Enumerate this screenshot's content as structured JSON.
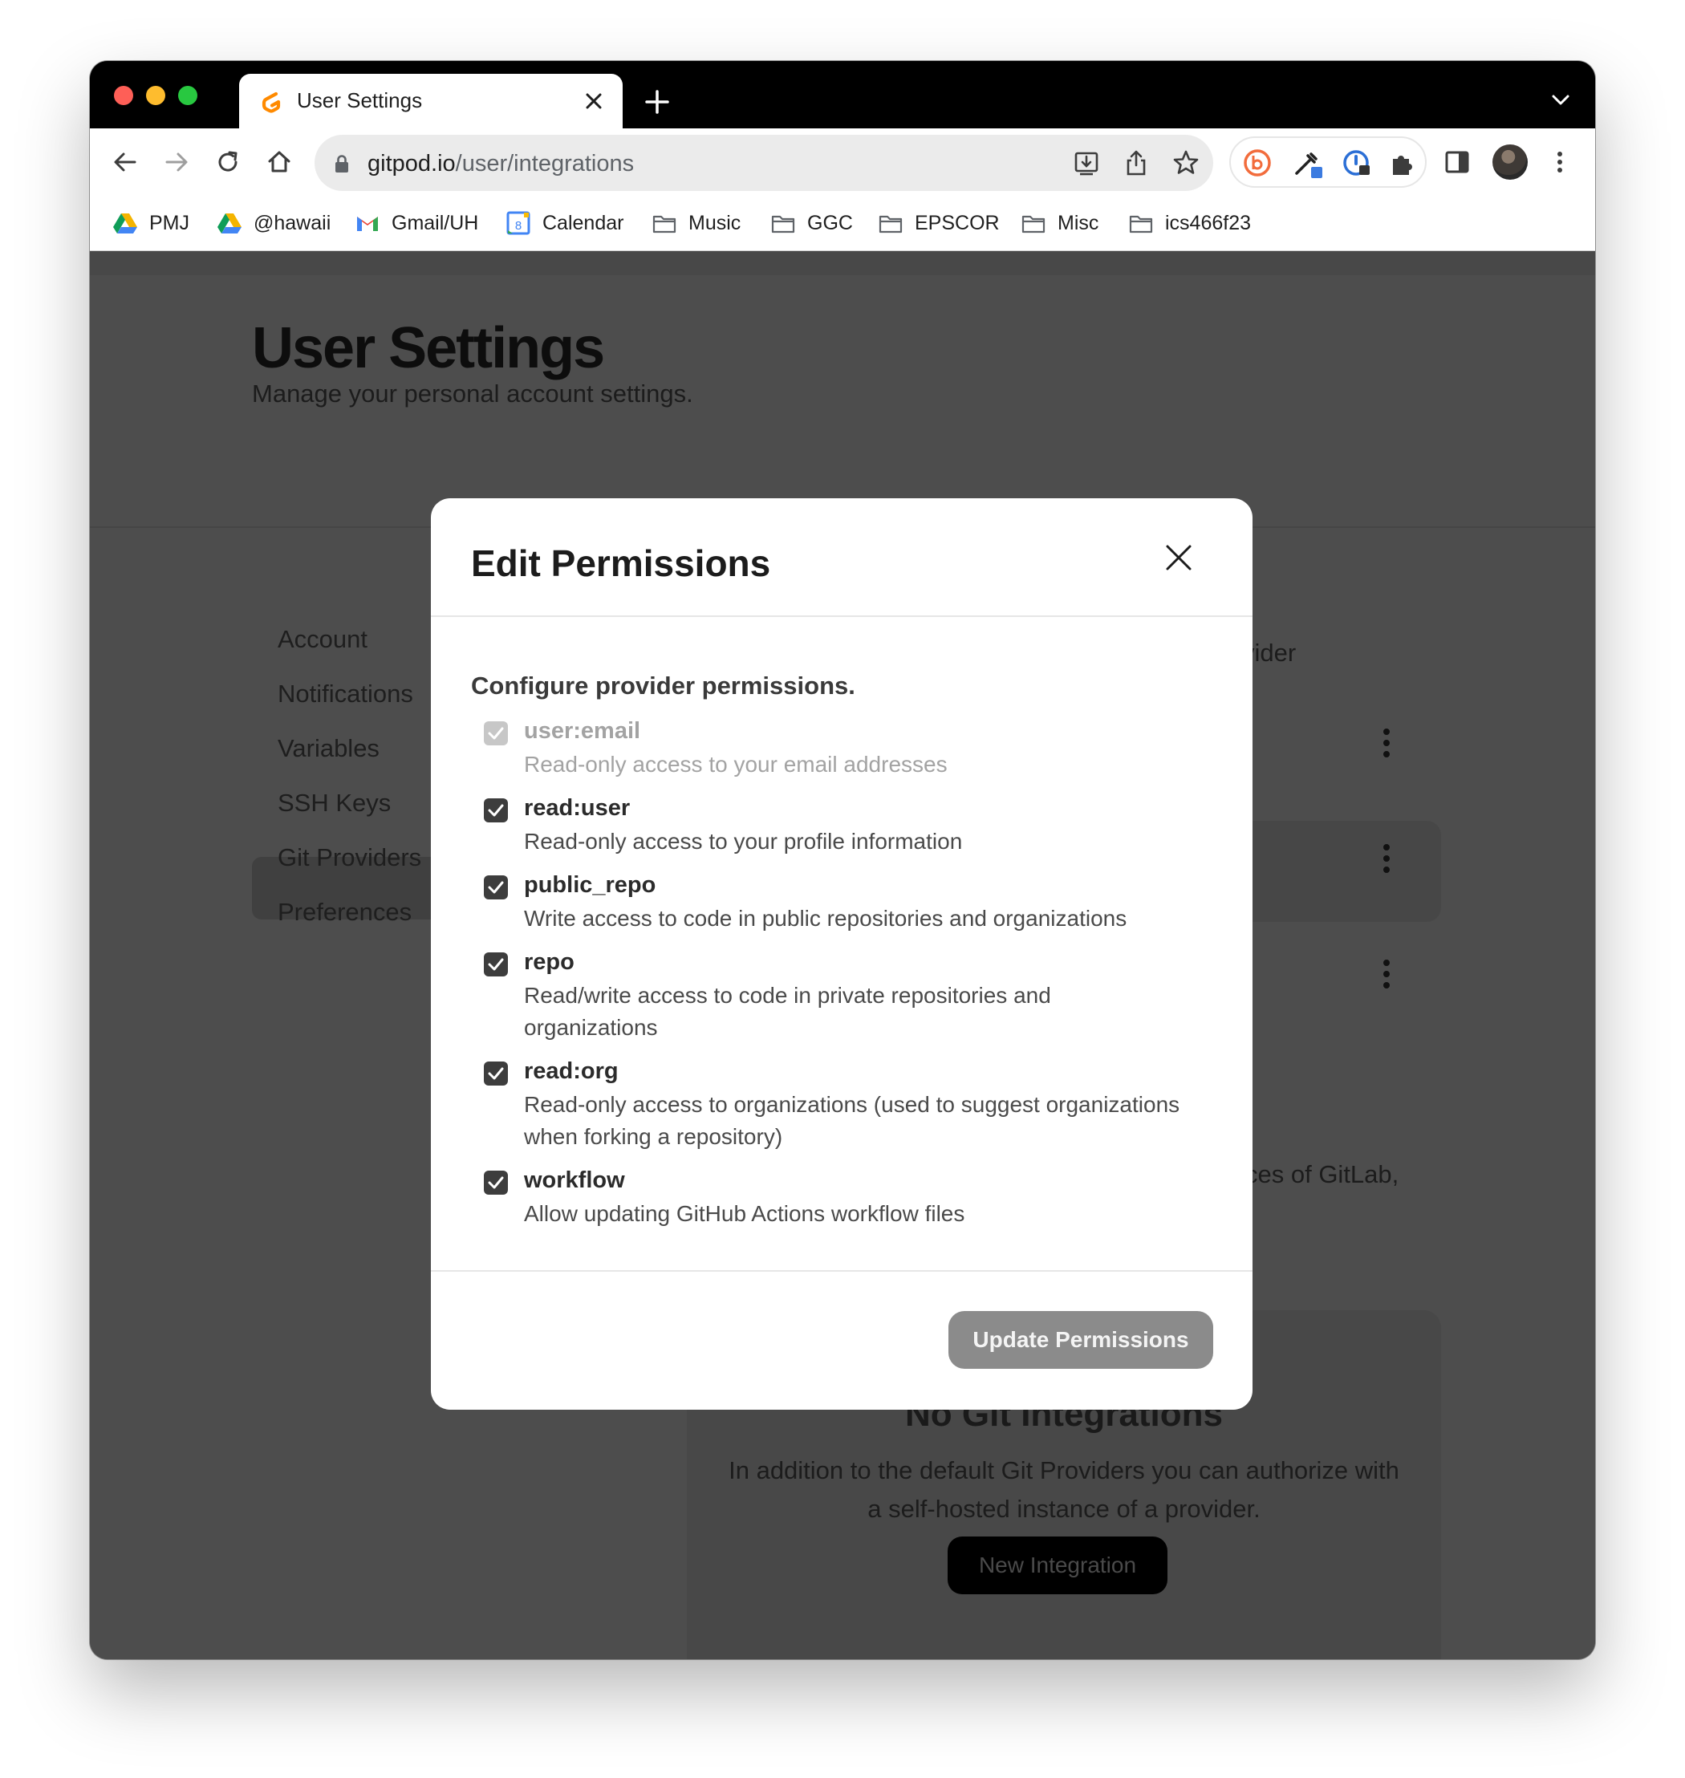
{
  "browser": {
    "tab_title": "User Settings",
    "url_host": "gitpod.io",
    "url_path": "/user/integrations",
    "bookmarks": [
      {
        "label": "PMJ",
        "icon": "google-drive-icon"
      },
      {
        "label": "@hawaii",
        "icon": "google-drive-icon"
      },
      {
        "label": "Gmail/UH",
        "icon": "gmail-icon"
      },
      {
        "label": "Calendar",
        "icon": "google-calendar-icon"
      },
      {
        "label": "Music",
        "icon": "folder-icon"
      },
      {
        "label": "GGC",
        "icon": "folder-icon"
      },
      {
        "label": "EPSCOR",
        "icon": "folder-icon"
      },
      {
        "label": "Misc",
        "icon": "folder-icon"
      },
      {
        "label": "ics466f23",
        "icon": "folder-icon"
      }
    ],
    "calendar_day": "8"
  },
  "page": {
    "title": "User Settings",
    "subtitle": "Manage your personal account settings.",
    "sidebar": [
      {
        "label": "Account"
      },
      {
        "label": "Notifications"
      },
      {
        "label": "Variables"
      },
      {
        "label": "SSH Keys"
      },
      {
        "label": "Git Providers",
        "active": true
      },
      {
        "label": "Preferences"
      }
    ],
    "fragment_provider": "vider",
    "fragment_gitlab": "ces of GitLab,",
    "empty_state": {
      "title": "No Git Integrations",
      "text": "In addition to the default Git Providers you can authorize with a self-hosted instance of a provider.",
      "button": "New Integration"
    }
  },
  "modal": {
    "title": "Edit Permissions",
    "intro": "Configure provider permissions.",
    "permissions": [
      {
        "name": "user:email",
        "description": "Read-only access to your email addresses",
        "checked": true,
        "disabled": true
      },
      {
        "name": "read:user",
        "description": "Read-only access to your profile information",
        "checked": true,
        "disabled": false
      },
      {
        "name": "public_repo",
        "description": "Write access to code in public repositories and organizations",
        "checked": true,
        "disabled": false
      },
      {
        "name": "repo",
        "description": "Read/write access to code in private repositories and organizations",
        "checked": true,
        "disabled": false
      },
      {
        "name": "read:org",
        "description": "Read-only access to organizations (used to suggest organizations when forking a repository)",
        "checked": true,
        "disabled": false
      },
      {
        "name": "workflow",
        "description": "Allow updating GitHub Actions workflow files",
        "checked": true,
        "disabled": false
      }
    ],
    "update_button": "Update Permissions"
  },
  "colors": {
    "traffic_close": "#fe5f57",
    "traffic_minimize": "#febc2e",
    "traffic_zoom": "#28c840",
    "gitpod_orange": "#ff8a00",
    "checkbox": "#3d3d3d",
    "button_disabled": "#8b8b8b"
  }
}
